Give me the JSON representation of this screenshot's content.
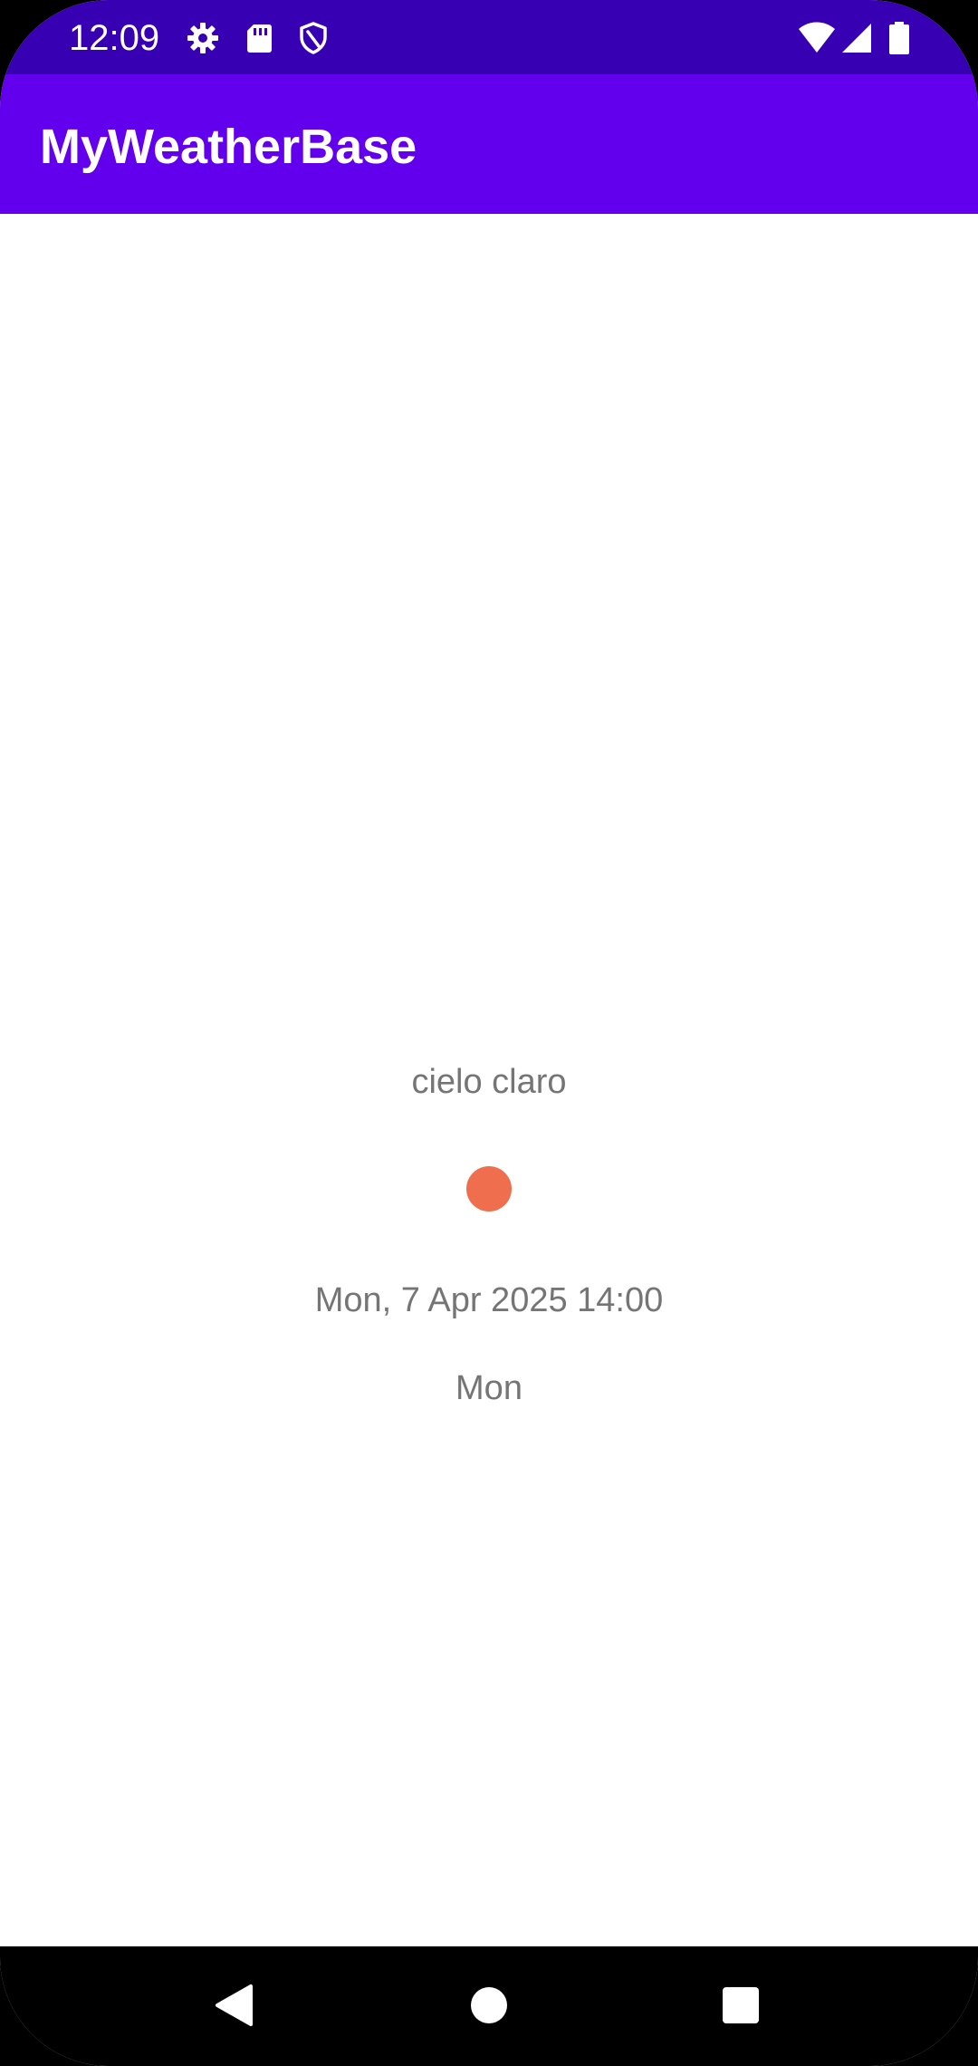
{
  "status_bar": {
    "time": "12:09",
    "icons_left": [
      "settings-icon",
      "sd-card-icon",
      "shield-icon"
    ],
    "icons_right": [
      "wifi-icon",
      "cell-signal-icon",
      "battery-icon"
    ]
  },
  "app_bar": {
    "title": "MyWeatherBase",
    "color": "#6200ee"
  },
  "forecast": {
    "description": "cielo claro",
    "icon": "sun-icon",
    "icon_color": "#ee6e4d",
    "datetime": "Mon, 7 Apr 2025 14:00",
    "day": "Mon"
  },
  "nav_bar": {
    "buttons": [
      "back-icon",
      "home-icon",
      "recents-icon"
    ]
  }
}
